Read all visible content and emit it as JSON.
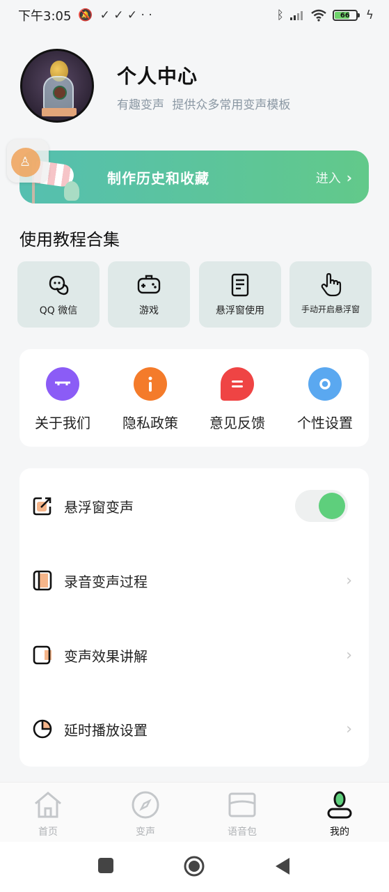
{
  "status_bar": {
    "time": "下午3:05",
    "notification_glyphs": "✓ ✓ ✓ · ·",
    "battery_level": "66"
  },
  "profile": {
    "title": "个人中心",
    "subtitle": "有趣变声  提供众多常用变声模板"
  },
  "history_banner": {
    "title": "制作历史和收藏",
    "enter_label": "进入"
  },
  "tutorials": {
    "section_title": "使用教程合集",
    "items": [
      {
        "label": "QQ 微信",
        "icon": "chat-bubbles-icon"
      },
      {
        "label": "游戏",
        "icon": "gamepad-icon"
      },
      {
        "label": "悬浮窗使用",
        "icon": "document-icon"
      },
      {
        "label": "手动开启悬浮窗",
        "icon": "hand-pointer-icon"
      }
    ]
  },
  "quick_links": {
    "items": [
      {
        "label": "关于我们",
        "icon": "info-bag-icon",
        "color": "#8b5cf6"
      },
      {
        "label": "隐私政策",
        "icon": "info-icon",
        "color": "#f47b2a"
      },
      {
        "label": "意见反馈",
        "icon": "feedback-icon",
        "color": "#ef4444"
      },
      {
        "label": "个性设置",
        "icon": "settings-hex-icon",
        "color": "#5aa8f0"
      }
    ]
  },
  "settings": {
    "items": [
      {
        "label": "悬浮窗变声",
        "icon": "share-out-icon",
        "control": "toggle",
        "toggle_on": true
      },
      {
        "label": "录音变声过程",
        "icon": "panel-icon",
        "control": "chevron"
      },
      {
        "label": "变声效果讲解",
        "icon": "square-icon",
        "control": "chevron"
      },
      {
        "label": "延时播放设置",
        "icon": "pie-timer-icon",
        "control": "chevron"
      }
    ]
  },
  "bottom_nav": {
    "items": [
      {
        "label": "首页",
        "icon": "home-icon",
        "active": false
      },
      {
        "label": "变声",
        "icon": "compass-icon",
        "active": false
      },
      {
        "label": "语音包",
        "icon": "box-icon",
        "active": false
      },
      {
        "label": "我的",
        "icon": "user-icon",
        "active": true
      }
    ]
  },
  "colors": {
    "accent_green": "#5ecf7c",
    "banner_start": "#55bfb0",
    "banner_end": "#62c98a"
  }
}
